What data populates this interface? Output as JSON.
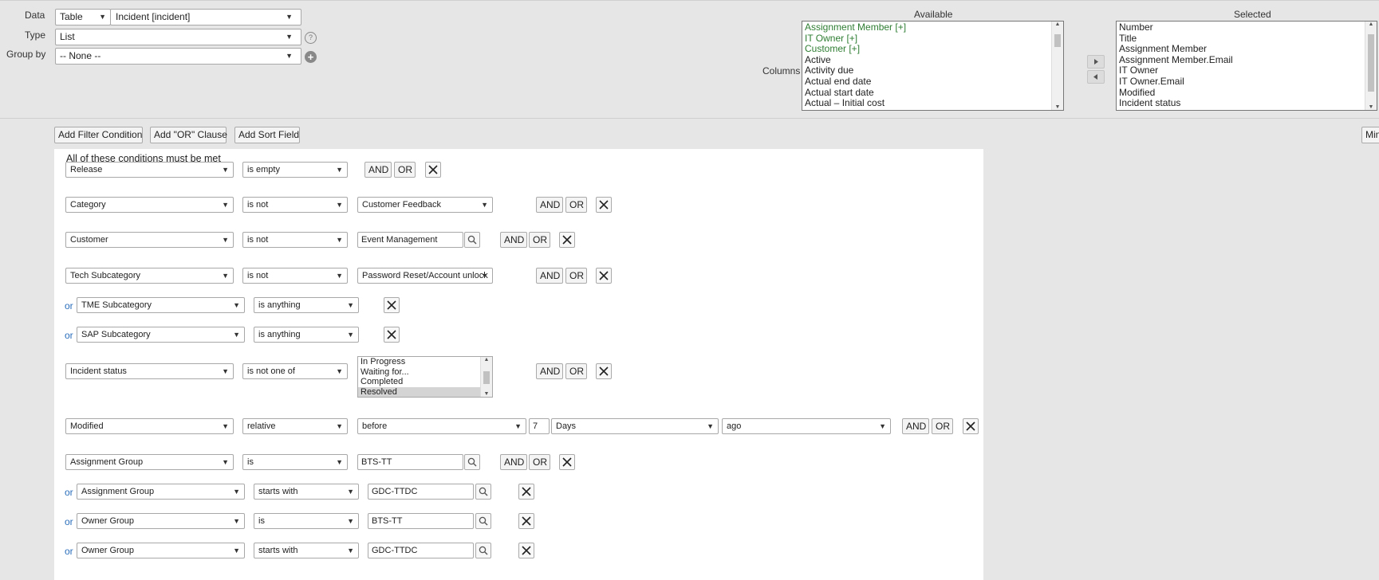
{
  "top": {
    "data_label": "Data",
    "type_label": "Type",
    "groupby_label": "Group by",
    "data_source": "Table",
    "table_value": "Incident [incident]",
    "type_value": "List",
    "groupby_value": "-- None --",
    "columns_label": "Columns",
    "available_label": "Available",
    "selected_label": "Selected",
    "available_items": [
      {
        "text": "Assignment Member [+]",
        "green": true
      },
      {
        "text": "IT Owner [+]",
        "green": true
      },
      {
        "text": "Customer [+]",
        "green": true
      },
      {
        "text": "Active",
        "green": false
      },
      {
        "text": "Activity due",
        "green": false
      },
      {
        "text": "Actual end date",
        "green": false
      },
      {
        "text": "Actual start date",
        "green": false
      },
      {
        "text": "Actual – Initial cost",
        "green": false
      }
    ],
    "selected_items": [
      "Number",
      "Title",
      "Assignment Member",
      "Assignment Member.Email",
      "IT Owner",
      "IT Owner.Email",
      "Modified",
      "Incident status"
    ]
  },
  "toolbar": {
    "add_filter": "Add Filter Condition",
    "add_or": "Add \"OR\" Clause",
    "add_sort": "Add Sort Field",
    "right_button": "Min"
  },
  "filter": {
    "heading": "All of these conditions must be met",
    "and_label": "AND",
    "or_label": "OR",
    "or_prefix": "or",
    "rows": [
      {
        "field": "Release",
        "op": "is empty"
      },
      {
        "field": "Category",
        "op": "is not",
        "value": "Customer Feedback"
      },
      {
        "field": "Customer",
        "op": "is not",
        "value": "Event Management"
      },
      {
        "field": "Tech Subcategory",
        "op": "is not",
        "value": "Password Reset/Account unlock"
      },
      {
        "field": "TME Subcategory",
        "op": "is anything"
      },
      {
        "field": "SAP Subcategory",
        "op": "is anything"
      },
      {
        "field": "Incident status",
        "op": "is not one of",
        "list": [
          "In Progress",
          "Waiting for...",
          "Completed",
          "Resolved"
        ]
      },
      {
        "field": "Modified",
        "op": "relative",
        "value": "before",
        "num": "7",
        "unit": "Days",
        "when": "ago"
      },
      {
        "field": "Assignment Group",
        "op": "is",
        "value": "BTS-TT"
      },
      {
        "field": "Assignment Group",
        "op": "starts with",
        "value": "GDC-TTDC"
      },
      {
        "field": "Owner Group",
        "op": "is",
        "value": "BTS-TT"
      },
      {
        "field": "Owner Group",
        "op": "starts with",
        "value": "GDC-TTDC"
      }
    ]
  }
}
